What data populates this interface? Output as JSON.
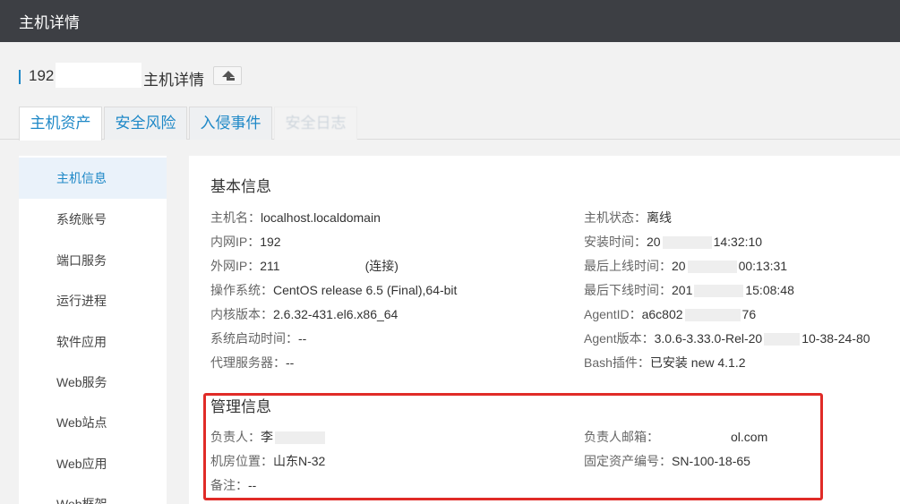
{
  "topbar": {
    "title": "主机详情"
  },
  "host": {
    "ip_prefix": "192",
    "title_suffix": "主机详情",
    "back_icon": "up-arrow-icon"
  },
  "tabs": [
    {
      "label": "主机资产"
    },
    {
      "label": "安全风险"
    },
    {
      "label": "入侵事件"
    },
    {
      "label": "安全日志"
    }
  ],
  "sidebar": {
    "items": [
      {
        "label": "主机信息"
      },
      {
        "label": "系统账号"
      },
      {
        "label": "端口服务"
      },
      {
        "label": "运行进程"
      },
      {
        "label": "软件应用"
      },
      {
        "label": "Web服务"
      },
      {
        "label": "Web站点"
      },
      {
        "label": "Web应用"
      },
      {
        "label": "Web框架"
      }
    ]
  },
  "basic": {
    "title": "基本信息",
    "hostname": {
      "key": "主机名：",
      "value": "localhost.localdomain"
    },
    "intranet_ip": {
      "key": "内网IP：",
      "value": "192"
    },
    "extranet_ip": {
      "key": "外网IP：",
      "value": "211",
      "suffix": "(连接)"
    },
    "os": {
      "key": "操作系统：",
      "value": "CentOS release 6.5 (Final),64-bit"
    },
    "kernel": {
      "key": "内核版本：",
      "value": "2.6.32-431.el6.x86_64"
    },
    "boot_time": {
      "key": "系统启动时间：",
      "value": "--"
    },
    "proxy": {
      "key": "代理服务器：",
      "value": "--"
    },
    "status": {
      "key": "主机状态：",
      "value": "离线"
    },
    "install_time": {
      "key": "安装时间：",
      "value_a": "20",
      "value_b": "14:32:10"
    },
    "last_online": {
      "key": "最后上线时间：",
      "value_a": "20",
      "value_b": "00:13:31"
    },
    "last_offline": {
      "key": "最后下线时间：",
      "value_a": "201",
      "value_b": "15:08:48"
    },
    "agent_id": {
      "key": "AgentID：",
      "value_a": "a6c802",
      "value_b": "76"
    },
    "agent_version": {
      "key": "Agent版本：",
      "value_a": "3.0.6-3.33.0-Rel-20",
      "value_b": "10-38-24-80"
    },
    "bash_plugin": {
      "key": "Bash插件：",
      "value": "已安装 new 4.1.2"
    }
  },
  "management": {
    "title": "管理信息",
    "owner": {
      "key": "负责人：",
      "value": "李"
    },
    "owner_email": {
      "key": "负责人邮箱：",
      "value": "ol.com"
    },
    "room": {
      "key": "机房位置：",
      "value": "山东N-32"
    },
    "asset_no": {
      "key": "固定资产编号：",
      "value": "SN-100-18-65"
    },
    "note": {
      "key": "备注：",
      "value": "--"
    }
  },
  "colors": {
    "accent": "#1e88c7",
    "topbar": "#3d3f44",
    "highlight": "#e02b27"
  }
}
